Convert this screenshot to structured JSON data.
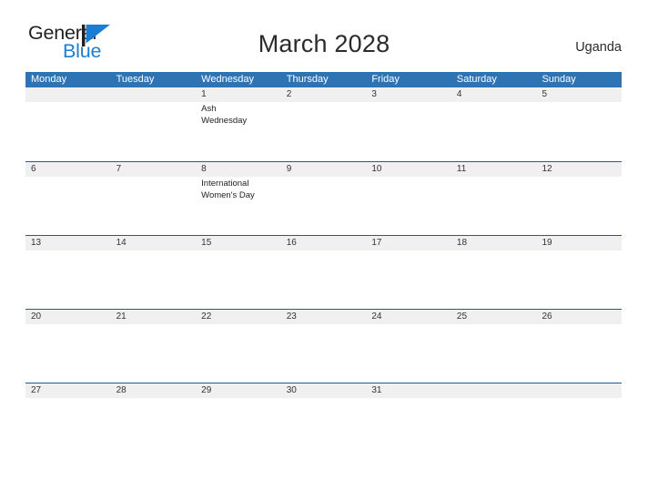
{
  "brand": {
    "name_part1": "General",
    "name_part2": "Blue",
    "flag_icon": "blue-flag-logo-icon"
  },
  "header": {
    "title": "March 2028",
    "region": "Uganda"
  },
  "calendar": {
    "weekdays": [
      "Monday",
      "Tuesday",
      "Wednesday",
      "Thursday",
      "Friday",
      "Saturday",
      "Sunday"
    ],
    "accent_color": "#2e74b5",
    "row_border_color": "#1f5c99",
    "date_band_color": "#f0f0f0",
    "weeks": [
      {
        "days": [
          {
            "number": "",
            "events": []
          },
          {
            "number": "",
            "events": []
          },
          {
            "number": "1",
            "events": [
              "Ash Wednesday"
            ]
          },
          {
            "number": "2",
            "events": []
          },
          {
            "number": "3",
            "events": []
          },
          {
            "number": "4",
            "events": []
          },
          {
            "number": "5",
            "events": []
          }
        ]
      },
      {
        "days": [
          {
            "number": "6",
            "events": []
          },
          {
            "number": "7",
            "events": []
          },
          {
            "number": "8",
            "events": [
              "International Women's Day"
            ]
          },
          {
            "number": "9",
            "events": []
          },
          {
            "number": "10",
            "events": []
          },
          {
            "number": "11",
            "events": []
          },
          {
            "number": "12",
            "events": []
          }
        ]
      },
      {
        "days": [
          {
            "number": "13",
            "events": []
          },
          {
            "number": "14",
            "events": []
          },
          {
            "number": "15",
            "events": []
          },
          {
            "number": "16",
            "events": []
          },
          {
            "number": "17",
            "events": []
          },
          {
            "number": "18",
            "events": []
          },
          {
            "number": "19",
            "events": []
          }
        ]
      },
      {
        "days": [
          {
            "number": "20",
            "events": []
          },
          {
            "number": "21",
            "events": []
          },
          {
            "number": "22",
            "events": []
          },
          {
            "number": "23",
            "events": []
          },
          {
            "number": "24",
            "events": []
          },
          {
            "number": "25",
            "events": []
          },
          {
            "number": "26",
            "events": []
          }
        ]
      },
      {
        "days": [
          {
            "number": "27",
            "events": []
          },
          {
            "number": "28",
            "events": []
          },
          {
            "number": "29",
            "events": []
          },
          {
            "number": "30",
            "events": []
          },
          {
            "number": "31",
            "events": []
          },
          {
            "number": "",
            "events": []
          },
          {
            "number": "",
            "events": []
          }
        ]
      }
    ]
  }
}
